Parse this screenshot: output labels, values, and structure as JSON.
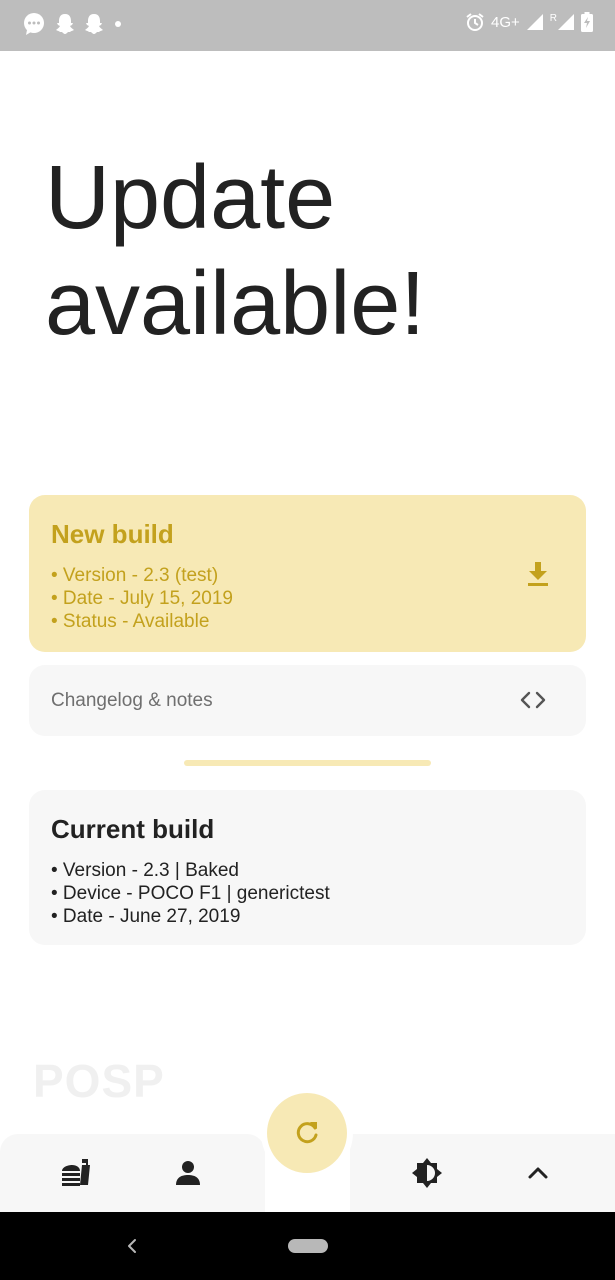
{
  "status_bar": {
    "network_label": "4G+",
    "roaming_label": "R"
  },
  "title": "Update available!",
  "new_build": {
    "heading": "New build",
    "lines": [
      "• Version - 2.3 (test)",
      "• Date - July 15, 2019",
      "• Status - Available"
    ]
  },
  "changelog": {
    "label": "Changelog & notes"
  },
  "current_build": {
    "heading": "Current build",
    "lines": [
      "• Version - 2.3 | Baked",
      "• Device - POCO F1 | generictest",
      "• Date - June 27, 2019"
    ]
  },
  "logo_text": "POSP",
  "icons": {
    "download": "download-icon",
    "code": "code-icon",
    "refresh": "refresh-icon",
    "food": "food-icon",
    "person": "person-icon",
    "theme": "theme-icon",
    "chevron_up": "chevron-up-icon",
    "back": "back-icon",
    "home": "home-pill"
  },
  "colors": {
    "accent": "#c3a11d",
    "accent_bg": "#f7e9b5",
    "card_bg": "#f7f7f7",
    "status_bar": "#bdbdbd"
  }
}
